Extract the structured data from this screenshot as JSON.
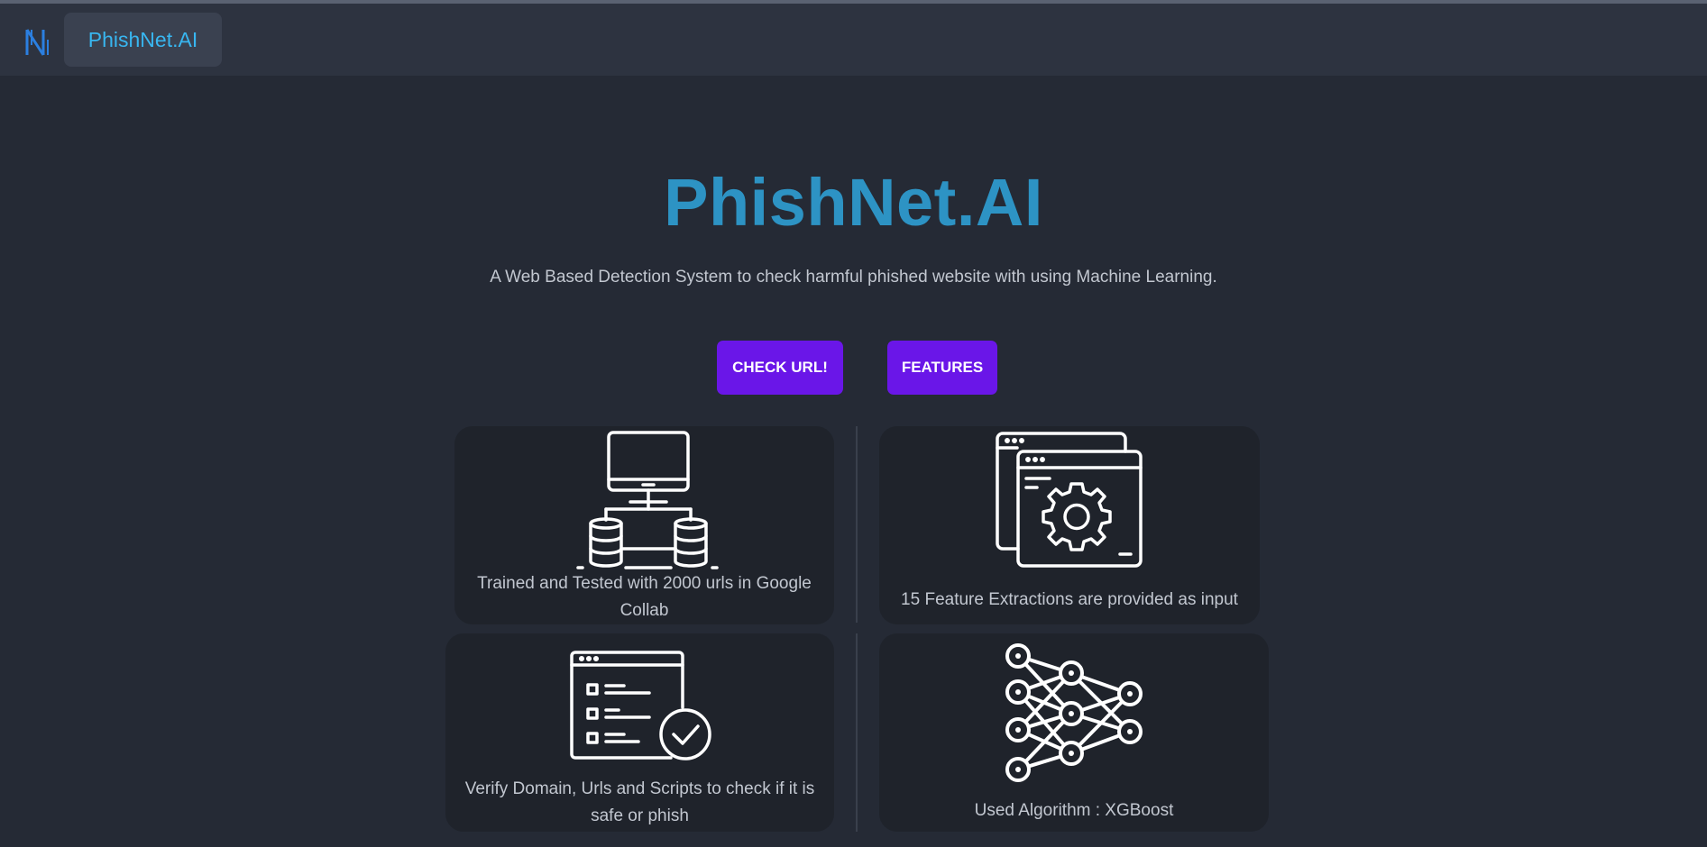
{
  "navbar": {
    "brand": "PhishNet.AI"
  },
  "hero": {
    "title": "PhishNet.AI",
    "subtitle": "A Web Based Detection System to check harmful phished website with using Machine Learning."
  },
  "buttons": {
    "check_url": "CHECK URL!",
    "features": "FEATURES"
  },
  "cards": [
    {
      "icon": "computer-database-icon",
      "text": "Trained and Tested with 2000 urls in Google Collab"
    },
    {
      "icon": "window-gear-icon",
      "text": "15 Feature Extractions are provided as input"
    },
    {
      "icon": "checklist-verify-icon",
      "text": "Verify Domain, Urls and Scripts to check if it is safe or phish"
    },
    {
      "icon": "neural-network-icon",
      "text": "Used Algorithm : XGBoost"
    }
  ],
  "colors": {
    "background": "#252a35",
    "navbar": "#2d3340",
    "accent_title": "#2d93c4",
    "button": "#6a16e8",
    "brand_text": "#38b6f0"
  }
}
